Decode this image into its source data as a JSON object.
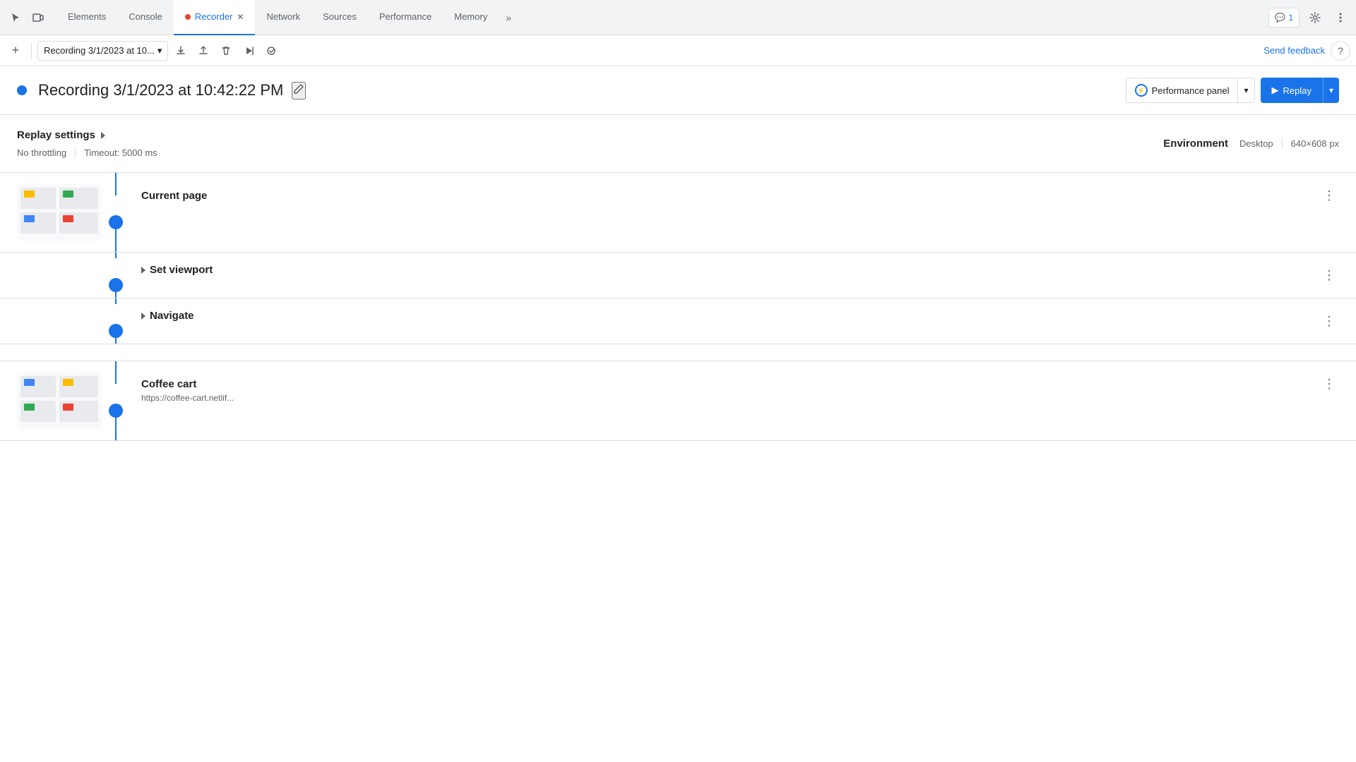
{
  "tabs": {
    "items": [
      {
        "label": "Elements",
        "active": false,
        "hasClose": false,
        "hasRecDot": false
      },
      {
        "label": "Console",
        "active": false,
        "hasClose": false,
        "hasRecDot": false
      },
      {
        "label": "Recorder",
        "active": true,
        "hasClose": true,
        "hasRecDot": true
      },
      {
        "label": "Network",
        "active": false,
        "hasClose": false,
        "hasRecDot": false
      },
      {
        "label": "Sources",
        "active": false,
        "hasClose": false,
        "hasRecDot": false
      },
      {
        "label": "Performance",
        "active": false,
        "hasClose": false,
        "hasRecDot": false
      },
      {
        "label": "Memory",
        "active": false,
        "hasClose": false,
        "hasRecDot": false
      }
    ],
    "more_label": "»"
  },
  "toolbar": {
    "add_label": "+",
    "recording_name": "Recording 3/1/2023 at 10...",
    "send_feedback": "Send feedback",
    "help_label": "?"
  },
  "recording": {
    "title": "Recording 3/1/2023 at 10:42:22 PM",
    "dot_color": "#1a73e8",
    "perf_panel_label": "Performance panel",
    "replay_label": "Replay"
  },
  "settings": {
    "title": "Replay settings",
    "throttling": "No throttling",
    "timeout": "Timeout: 5000 ms",
    "environment_label": "Environment",
    "desktop_label": "Desktop",
    "resolution": "640×608 px"
  },
  "steps": [
    {
      "id": "current-page",
      "title": "Current page",
      "hasThumbnail": true,
      "url": null,
      "expandable": false
    },
    {
      "id": "set-viewport",
      "title": "Set viewport",
      "hasThumbnail": false,
      "url": null,
      "expandable": true
    },
    {
      "id": "navigate",
      "title": "Navigate",
      "hasThumbnail": false,
      "url": null,
      "expandable": true
    },
    {
      "id": "coffee-cart",
      "title": "Coffee cart",
      "hasThumbnail": true,
      "url": "https://coffee-cart.netlif...",
      "expandable": false
    }
  ],
  "notification": {
    "icon": "💬",
    "count": "1"
  },
  "colors": {
    "accent": "#1a73e8",
    "active_tab_border": "#1a73e8",
    "dot_blue": "#1a73e8",
    "timeline_blue": "#1a73e8"
  }
}
